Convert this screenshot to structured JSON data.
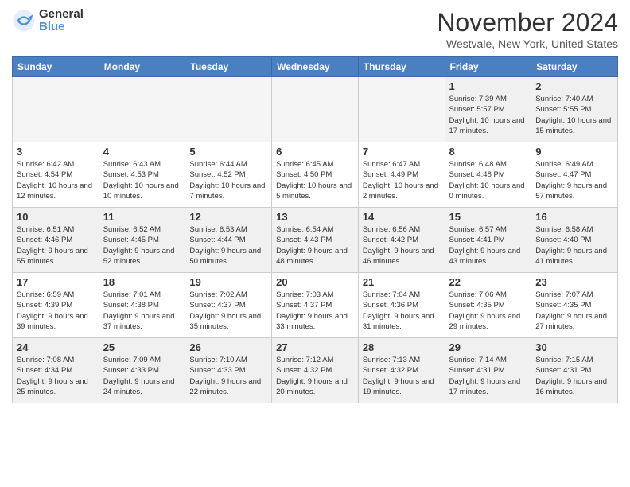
{
  "header": {
    "logo": {
      "general": "General",
      "blue": "Blue"
    },
    "title": "November 2024",
    "location": "Westvale, New York, United States"
  },
  "weekdays": [
    "Sunday",
    "Monday",
    "Tuesday",
    "Wednesday",
    "Thursday",
    "Friday",
    "Saturday"
  ],
  "weeks": [
    [
      {
        "day": "",
        "empty": true
      },
      {
        "day": "",
        "empty": true
      },
      {
        "day": "",
        "empty": true
      },
      {
        "day": "",
        "empty": true
      },
      {
        "day": "",
        "empty": true
      },
      {
        "day": "1",
        "info": "Sunrise: 7:39 AM\nSunset: 5:57 PM\nDaylight: 10 hours and 17 minutes."
      },
      {
        "day": "2",
        "info": "Sunrise: 7:40 AM\nSunset: 5:55 PM\nDaylight: 10 hours and 15 minutes."
      }
    ],
    [
      {
        "day": "3",
        "info": "Sunrise: 6:42 AM\nSunset: 4:54 PM\nDaylight: 10 hours and 12 minutes."
      },
      {
        "day": "4",
        "info": "Sunrise: 6:43 AM\nSunset: 4:53 PM\nDaylight: 10 hours and 10 minutes."
      },
      {
        "day": "5",
        "info": "Sunrise: 6:44 AM\nSunset: 4:52 PM\nDaylight: 10 hours and 7 minutes."
      },
      {
        "day": "6",
        "info": "Sunrise: 6:45 AM\nSunset: 4:50 PM\nDaylight: 10 hours and 5 minutes."
      },
      {
        "day": "7",
        "info": "Sunrise: 6:47 AM\nSunset: 4:49 PM\nDaylight: 10 hours and 2 minutes."
      },
      {
        "day": "8",
        "info": "Sunrise: 6:48 AM\nSunset: 4:48 PM\nDaylight: 10 hours and 0 minutes."
      },
      {
        "day": "9",
        "info": "Sunrise: 6:49 AM\nSunset: 4:47 PM\nDaylight: 9 hours and 57 minutes."
      }
    ],
    [
      {
        "day": "10",
        "info": "Sunrise: 6:51 AM\nSunset: 4:46 PM\nDaylight: 9 hours and 55 minutes."
      },
      {
        "day": "11",
        "info": "Sunrise: 6:52 AM\nSunset: 4:45 PM\nDaylight: 9 hours and 52 minutes."
      },
      {
        "day": "12",
        "info": "Sunrise: 6:53 AM\nSunset: 4:44 PM\nDaylight: 9 hours and 50 minutes."
      },
      {
        "day": "13",
        "info": "Sunrise: 6:54 AM\nSunset: 4:43 PM\nDaylight: 9 hours and 48 minutes."
      },
      {
        "day": "14",
        "info": "Sunrise: 6:56 AM\nSunset: 4:42 PM\nDaylight: 9 hours and 46 minutes."
      },
      {
        "day": "15",
        "info": "Sunrise: 6:57 AM\nSunset: 4:41 PM\nDaylight: 9 hours and 43 minutes."
      },
      {
        "day": "16",
        "info": "Sunrise: 6:58 AM\nSunset: 4:40 PM\nDaylight: 9 hours and 41 minutes."
      }
    ],
    [
      {
        "day": "17",
        "info": "Sunrise: 6:59 AM\nSunset: 4:39 PM\nDaylight: 9 hours and 39 minutes."
      },
      {
        "day": "18",
        "info": "Sunrise: 7:01 AM\nSunset: 4:38 PM\nDaylight: 9 hours and 37 minutes."
      },
      {
        "day": "19",
        "info": "Sunrise: 7:02 AM\nSunset: 4:37 PM\nDaylight: 9 hours and 35 minutes."
      },
      {
        "day": "20",
        "info": "Sunrise: 7:03 AM\nSunset: 4:37 PM\nDaylight: 9 hours and 33 minutes."
      },
      {
        "day": "21",
        "info": "Sunrise: 7:04 AM\nSunset: 4:36 PM\nDaylight: 9 hours and 31 minutes."
      },
      {
        "day": "22",
        "info": "Sunrise: 7:06 AM\nSunset: 4:35 PM\nDaylight: 9 hours and 29 minutes."
      },
      {
        "day": "23",
        "info": "Sunrise: 7:07 AM\nSunset: 4:35 PM\nDaylight: 9 hours and 27 minutes."
      }
    ],
    [
      {
        "day": "24",
        "info": "Sunrise: 7:08 AM\nSunset: 4:34 PM\nDaylight: 9 hours and 25 minutes."
      },
      {
        "day": "25",
        "info": "Sunrise: 7:09 AM\nSunset: 4:33 PM\nDaylight: 9 hours and 24 minutes."
      },
      {
        "day": "26",
        "info": "Sunrise: 7:10 AM\nSunset: 4:33 PM\nDaylight: 9 hours and 22 minutes."
      },
      {
        "day": "27",
        "info": "Sunrise: 7:12 AM\nSunset: 4:32 PM\nDaylight: 9 hours and 20 minutes."
      },
      {
        "day": "28",
        "info": "Sunrise: 7:13 AM\nSunset: 4:32 PM\nDaylight: 9 hours and 19 minutes."
      },
      {
        "day": "29",
        "info": "Sunrise: 7:14 AM\nSunset: 4:31 PM\nDaylight: 9 hours and 17 minutes."
      },
      {
        "day": "30",
        "info": "Sunrise: 7:15 AM\nSunset: 4:31 PM\nDaylight: 9 hours and 16 minutes."
      }
    ]
  ]
}
